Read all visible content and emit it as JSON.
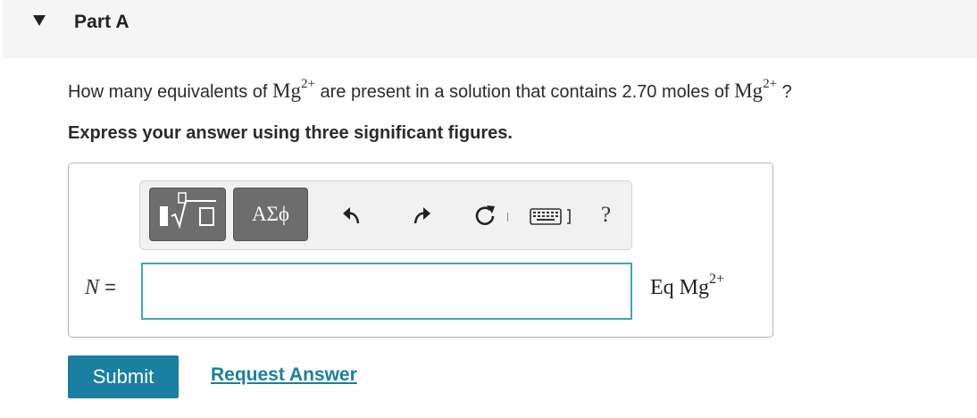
{
  "header": {
    "title": "Part A",
    "collapse_icon": "triangle-down-icon"
  },
  "question": {
    "prefix": "How many equivalents of ",
    "ion_symbol": "Mg",
    "ion_charge": "2+",
    "middle": " are present in a solution that contains 2.70 moles of ",
    "suffix": " ?"
  },
  "instruction": "Express your answer using three significant figures.",
  "toolbar": {
    "templates_icon": "templates-sqrt-icon",
    "symbols_label": "ΑΣϕ",
    "undo_icon": "undo-arrow-icon",
    "redo_icon": "redo-arrow-icon",
    "reset_icon": "reset-icon",
    "keyboard_icon": "keyboard-icon",
    "help_label": "?"
  },
  "answer": {
    "variable": "N",
    "equals": " = ",
    "value": "",
    "unit_main": "Eq Mg",
    "unit_charge": "2+"
  },
  "actions": {
    "submit_label": "Submit",
    "request_label": "Request Answer"
  },
  "colors": {
    "header_bg": "#f5f5f5",
    "accent": "#1a7fa0",
    "input_border": "#3aa6c8",
    "toolbar_button": "#6d6d6d"
  }
}
